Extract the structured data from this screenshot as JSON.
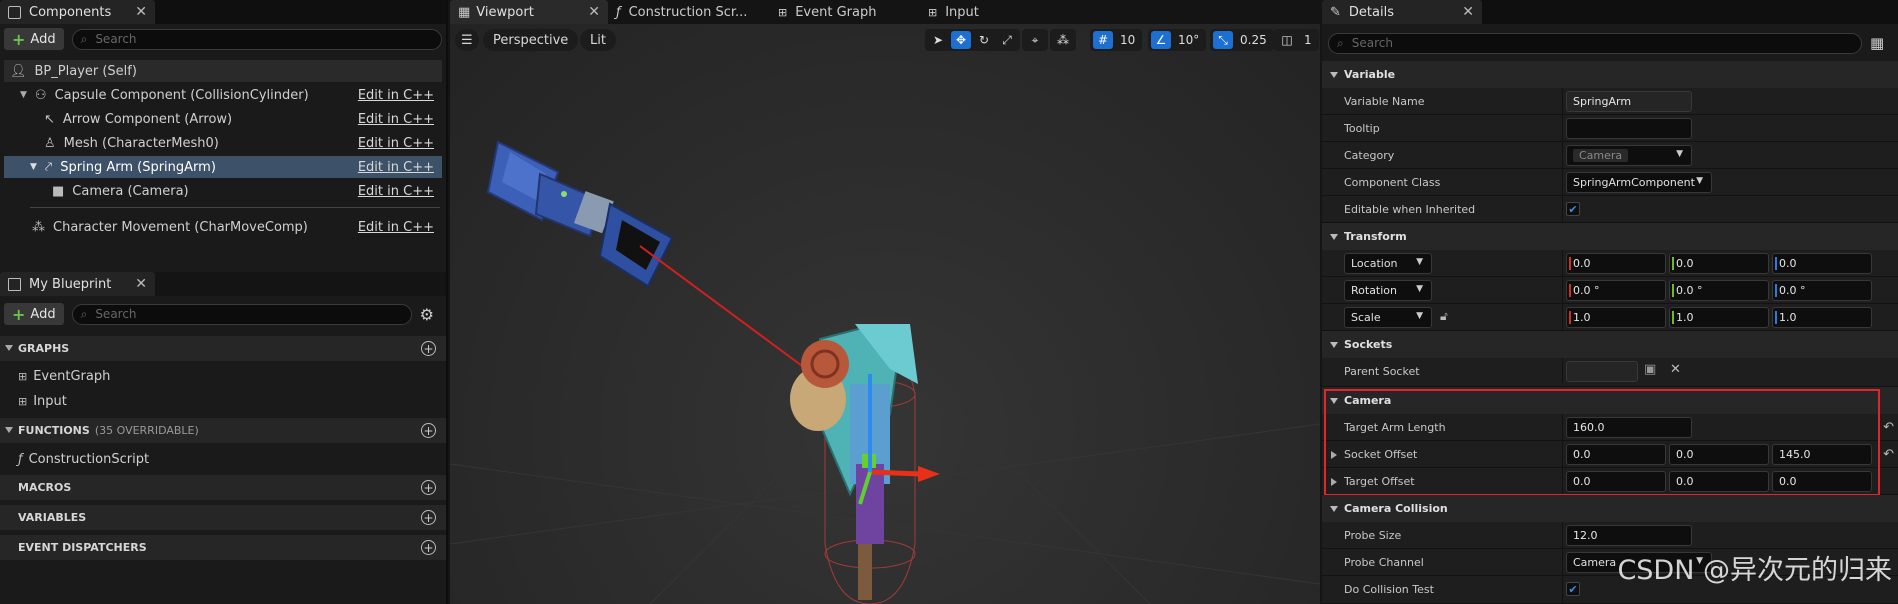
{
  "components": {
    "tab_label": "Components",
    "add_label": "Add",
    "search_placeholder": "Search",
    "root": "BP_Player (Self)",
    "edit_label": "Edit in C++",
    "items": [
      {
        "label": "Capsule Component (CollisionCylinder)"
      },
      {
        "label": "Arrow Component (Arrow)"
      },
      {
        "label": "Mesh (CharacterMesh0)"
      },
      {
        "label": "Spring Arm (SpringArm)"
      },
      {
        "label": "Camera (Camera)"
      },
      {
        "label": "Character Movement (CharMoveComp)"
      }
    ]
  },
  "my_blueprint": {
    "tab_label": "My Blueprint",
    "add_label": "Add",
    "search_placeholder": "Search",
    "graphs_header": "GRAPHS",
    "graphs": [
      "EventGraph",
      "Input"
    ],
    "functions_header": "FUNCTIONS",
    "functions_sub": "(35 OVERRIDABLE)",
    "functions": [
      "ConstructionScript"
    ],
    "macros_header": "MACROS",
    "variables_header": "VARIABLES",
    "dispatchers_header": "EVENT DISPATCHERS"
  },
  "editor_tabs": [
    {
      "label": "Viewport"
    },
    {
      "label": "Construction Scr..."
    },
    {
      "label": "Event Graph"
    },
    {
      "label": "Input"
    }
  ],
  "viewport": {
    "perspective": "Perspective",
    "lit": "Lit",
    "grid_snap": "10",
    "rot_snap": "10°",
    "scale_snap": "0.25",
    "cam_speed": "1"
  },
  "details": {
    "tab_label": "Details",
    "search_placeholder": "Search",
    "variable_header": "Variable",
    "variable_name_label": "Variable Name",
    "variable_name_value": "SpringArm",
    "tooltip_label": "Tooltip",
    "category_label": "Category",
    "category_value": "Camera",
    "component_class_label": "Component Class",
    "component_class_value": "SpringArmComponent",
    "editable_label": "Editable when Inherited",
    "transform_header": "Transform",
    "location_label": "Location",
    "rotation_label": "Rotation",
    "scale_label": "Scale",
    "location": [
      "0.0",
      "0.0",
      "0.0"
    ],
    "rotation": [
      "0.0 °",
      "0.0 °",
      "0.0 °"
    ],
    "scale": [
      "1.0",
      "1.0",
      "1.0"
    ],
    "sockets_header": "Sockets",
    "parent_socket_label": "Parent Socket",
    "camera_header": "Camera",
    "target_arm_length_label": "Target Arm Length",
    "target_arm_length_value": "160.0",
    "socket_offset_label": "Socket Offset",
    "socket_offset": [
      "0.0",
      "0.0",
      "145.0"
    ],
    "target_offset_label": "Target Offset",
    "target_offset": [
      "0.0",
      "0.0",
      "0.0"
    ],
    "camera_collision_header": "Camera Collision",
    "probe_size_label": "Probe Size",
    "probe_size_value": "12.0",
    "probe_channel_label": "Probe Channel",
    "probe_channel_value": "Camera",
    "do_collision_label": "Do Collision Test"
  },
  "watermark": "CSDN @异次元的归来",
  "colors": {
    "selection": "#3d5168",
    "accent": "#1e6fd2",
    "highlight_box": "#e0262b"
  }
}
